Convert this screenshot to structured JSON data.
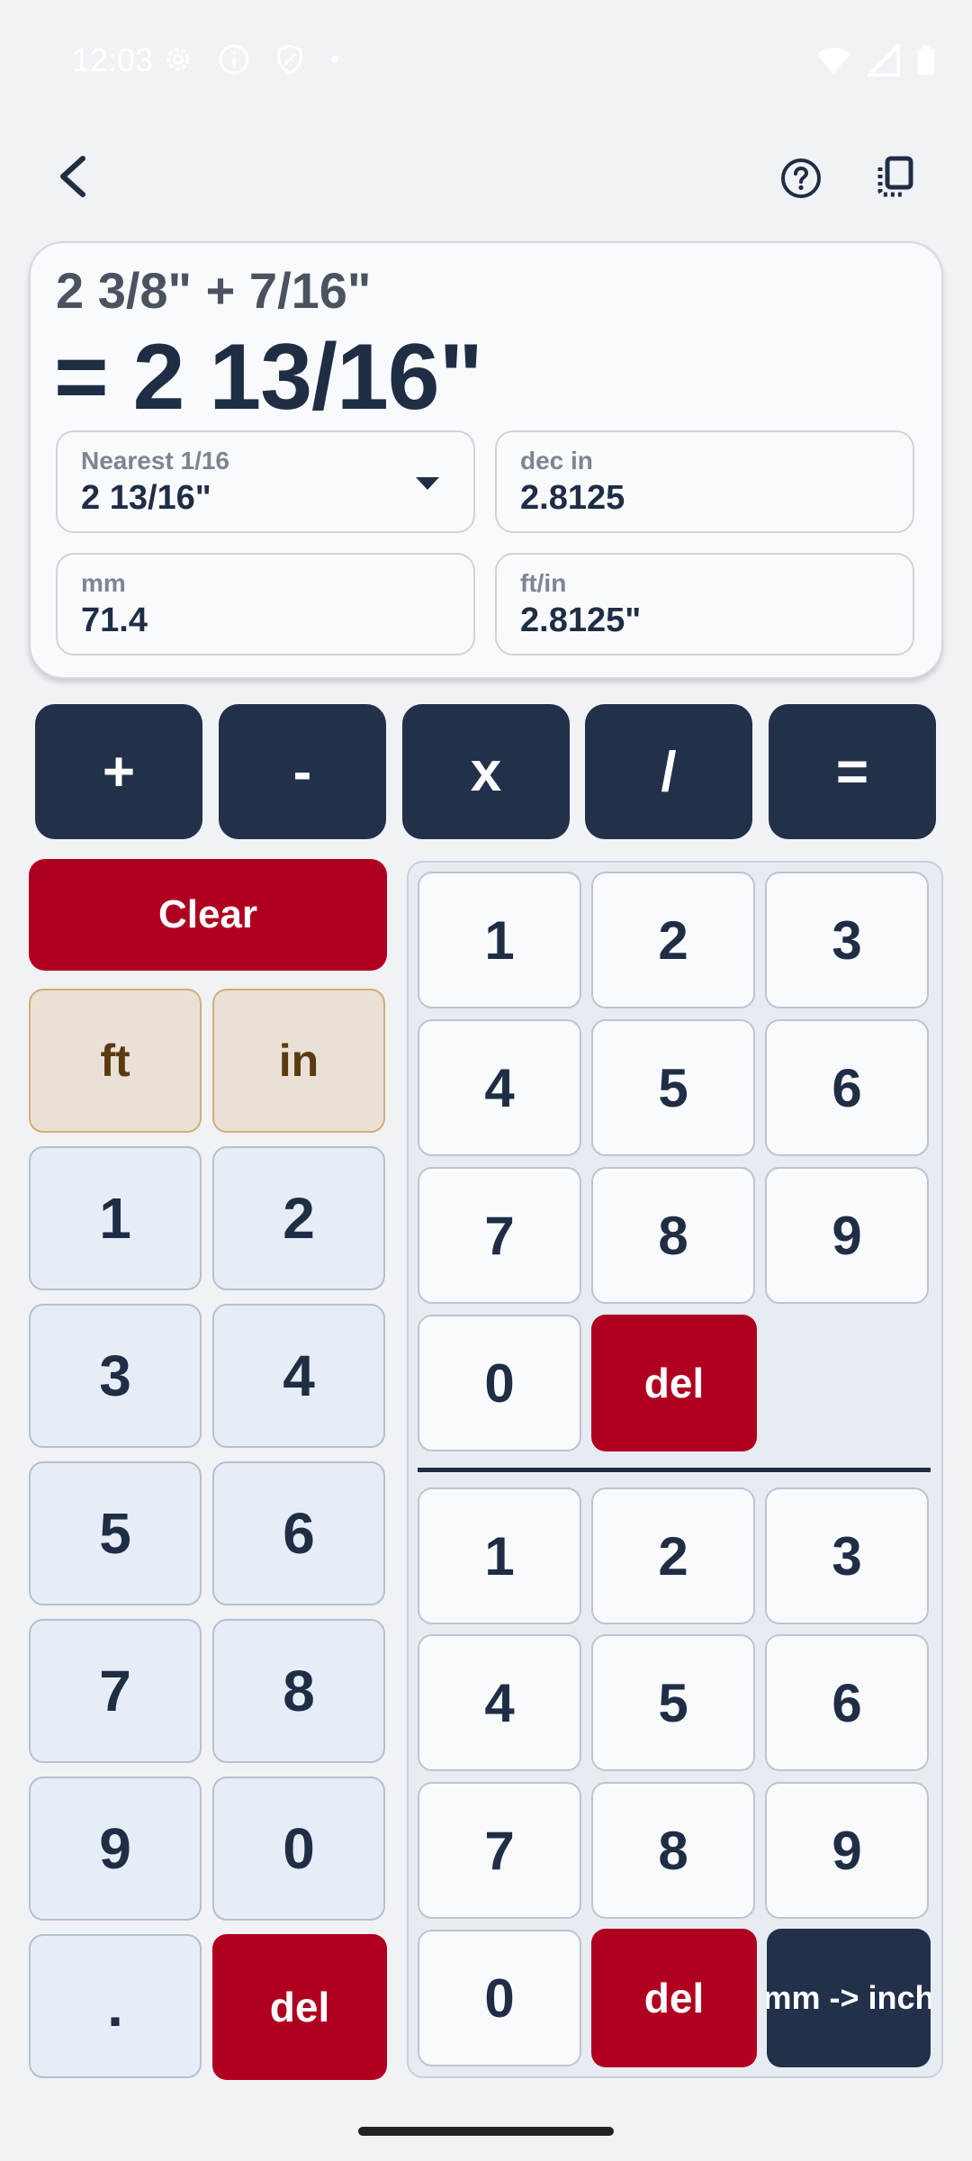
{
  "status_bar": {
    "time": "12:03",
    "icons_left": [
      "gear-icon",
      "info-icon",
      "shield-icon",
      "dot-icon"
    ],
    "icons_right": [
      "wifi-icon",
      "signal-icon",
      "battery-icon"
    ]
  },
  "app_bar": {
    "back_icon": "chevron-left-icon",
    "help_icon": "help-circle-icon",
    "copy_icon": "copy-icon"
  },
  "result_card": {
    "expression": "2 3/8\" + 7/16\"",
    "result": "= 2 13/16\"",
    "nearest": {
      "label": "Nearest 1/16",
      "value": "2 13/16\""
    },
    "dec_in": {
      "label": "dec in",
      "value": "2.8125"
    },
    "mm": {
      "label": "mm",
      "value": "71.4"
    },
    "ft_in": {
      "label": "ft/in",
      "value": "2.8125\""
    }
  },
  "operators": [
    "+",
    "-",
    "x",
    "/",
    "="
  ],
  "left_keypad": {
    "clear": "Clear",
    "ft": "ft",
    "in": "in",
    "digits": [
      "1",
      "2",
      "3",
      "4",
      "5",
      "6",
      "7",
      "8",
      "9",
      "0"
    ],
    "dot": ".",
    "del": "del"
  },
  "numerator_keypad": {
    "digits": [
      "1",
      "2",
      "3",
      "4",
      "5",
      "6",
      "7",
      "8",
      "9",
      "0"
    ],
    "del": "del"
  },
  "denominator_keypad": {
    "digits": [
      "1",
      "2",
      "3",
      "4",
      "5",
      "6",
      "7",
      "8",
      "9",
      "0"
    ],
    "del": "del",
    "convert": "mm -> inch"
  },
  "colors": {
    "primary_dark": "#22304a",
    "danger": "#b00020",
    "unit_key_bg": "#e9e1d6",
    "unit_key_text": "#5b3a10",
    "background": "#f0f2f6"
  }
}
